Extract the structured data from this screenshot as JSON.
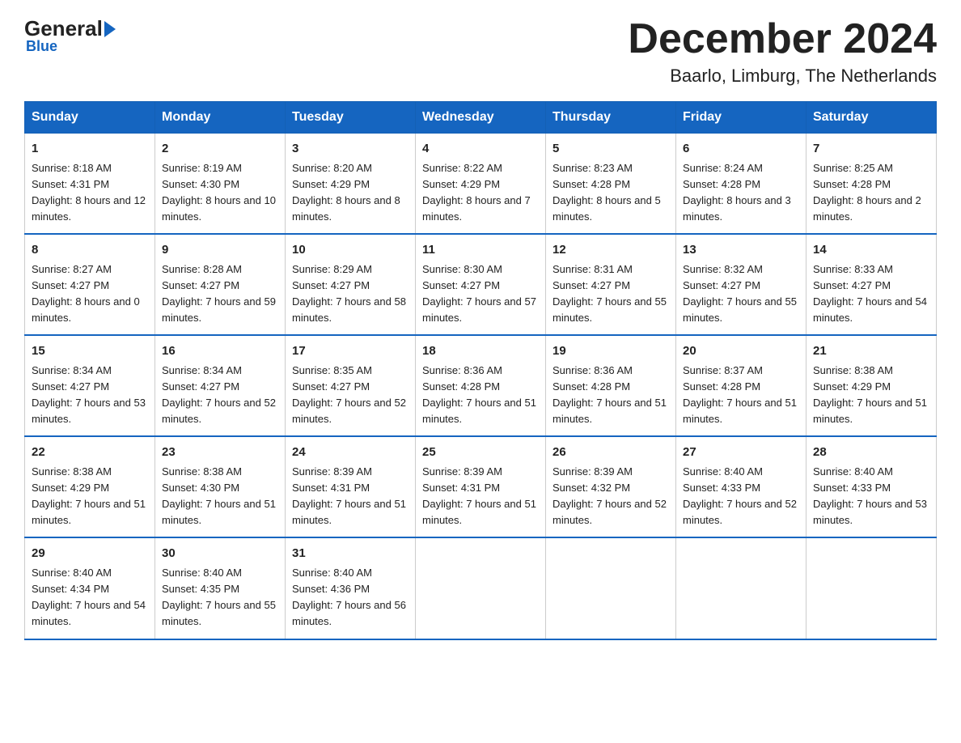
{
  "header": {
    "logo_main": "General",
    "logo_sub": "Blue",
    "title": "December 2024",
    "location": "Baarlo, Limburg, The Netherlands"
  },
  "columns": [
    "Sunday",
    "Monday",
    "Tuesday",
    "Wednesday",
    "Thursday",
    "Friday",
    "Saturday"
  ],
  "weeks": [
    [
      {
        "day": "1",
        "sunrise": "8:18 AM",
        "sunset": "4:31 PM",
        "daylight": "8 hours and 12 minutes."
      },
      {
        "day": "2",
        "sunrise": "8:19 AM",
        "sunset": "4:30 PM",
        "daylight": "8 hours and 10 minutes."
      },
      {
        "day": "3",
        "sunrise": "8:20 AM",
        "sunset": "4:29 PM",
        "daylight": "8 hours and 8 minutes."
      },
      {
        "day": "4",
        "sunrise": "8:22 AM",
        "sunset": "4:29 PM",
        "daylight": "8 hours and 7 minutes."
      },
      {
        "day": "5",
        "sunrise": "8:23 AM",
        "sunset": "4:28 PM",
        "daylight": "8 hours and 5 minutes."
      },
      {
        "day": "6",
        "sunrise": "8:24 AM",
        "sunset": "4:28 PM",
        "daylight": "8 hours and 3 minutes."
      },
      {
        "day": "7",
        "sunrise": "8:25 AM",
        "sunset": "4:28 PM",
        "daylight": "8 hours and 2 minutes."
      }
    ],
    [
      {
        "day": "8",
        "sunrise": "8:27 AM",
        "sunset": "4:27 PM",
        "daylight": "8 hours and 0 minutes."
      },
      {
        "day": "9",
        "sunrise": "8:28 AM",
        "sunset": "4:27 PM",
        "daylight": "7 hours and 59 minutes."
      },
      {
        "day": "10",
        "sunrise": "8:29 AM",
        "sunset": "4:27 PM",
        "daylight": "7 hours and 58 minutes."
      },
      {
        "day": "11",
        "sunrise": "8:30 AM",
        "sunset": "4:27 PM",
        "daylight": "7 hours and 57 minutes."
      },
      {
        "day": "12",
        "sunrise": "8:31 AM",
        "sunset": "4:27 PM",
        "daylight": "7 hours and 55 minutes."
      },
      {
        "day": "13",
        "sunrise": "8:32 AM",
        "sunset": "4:27 PM",
        "daylight": "7 hours and 55 minutes."
      },
      {
        "day": "14",
        "sunrise": "8:33 AM",
        "sunset": "4:27 PM",
        "daylight": "7 hours and 54 minutes."
      }
    ],
    [
      {
        "day": "15",
        "sunrise": "8:34 AM",
        "sunset": "4:27 PM",
        "daylight": "7 hours and 53 minutes."
      },
      {
        "day": "16",
        "sunrise": "8:34 AM",
        "sunset": "4:27 PM",
        "daylight": "7 hours and 52 minutes."
      },
      {
        "day": "17",
        "sunrise": "8:35 AM",
        "sunset": "4:27 PM",
        "daylight": "7 hours and 52 minutes."
      },
      {
        "day": "18",
        "sunrise": "8:36 AM",
        "sunset": "4:28 PM",
        "daylight": "7 hours and 51 minutes."
      },
      {
        "day": "19",
        "sunrise": "8:36 AM",
        "sunset": "4:28 PM",
        "daylight": "7 hours and 51 minutes."
      },
      {
        "day": "20",
        "sunrise": "8:37 AM",
        "sunset": "4:28 PM",
        "daylight": "7 hours and 51 minutes."
      },
      {
        "day": "21",
        "sunrise": "8:38 AM",
        "sunset": "4:29 PM",
        "daylight": "7 hours and 51 minutes."
      }
    ],
    [
      {
        "day": "22",
        "sunrise": "8:38 AM",
        "sunset": "4:29 PM",
        "daylight": "7 hours and 51 minutes."
      },
      {
        "day": "23",
        "sunrise": "8:38 AM",
        "sunset": "4:30 PM",
        "daylight": "7 hours and 51 minutes."
      },
      {
        "day": "24",
        "sunrise": "8:39 AM",
        "sunset": "4:31 PM",
        "daylight": "7 hours and 51 minutes."
      },
      {
        "day": "25",
        "sunrise": "8:39 AM",
        "sunset": "4:31 PM",
        "daylight": "7 hours and 51 minutes."
      },
      {
        "day": "26",
        "sunrise": "8:39 AM",
        "sunset": "4:32 PM",
        "daylight": "7 hours and 52 minutes."
      },
      {
        "day": "27",
        "sunrise": "8:40 AM",
        "sunset": "4:33 PM",
        "daylight": "7 hours and 52 minutes."
      },
      {
        "day": "28",
        "sunrise": "8:40 AM",
        "sunset": "4:33 PM",
        "daylight": "7 hours and 53 minutes."
      }
    ],
    [
      {
        "day": "29",
        "sunrise": "8:40 AM",
        "sunset": "4:34 PM",
        "daylight": "7 hours and 54 minutes."
      },
      {
        "day": "30",
        "sunrise": "8:40 AM",
        "sunset": "4:35 PM",
        "daylight": "7 hours and 55 minutes."
      },
      {
        "day": "31",
        "sunrise": "8:40 AM",
        "sunset": "4:36 PM",
        "daylight": "7 hours and 56 minutes."
      },
      null,
      null,
      null,
      null
    ]
  ],
  "labels": {
    "sunrise": "Sunrise:",
    "sunset": "Sunset:",
    "daylight": "Daylight:"
  }
}
